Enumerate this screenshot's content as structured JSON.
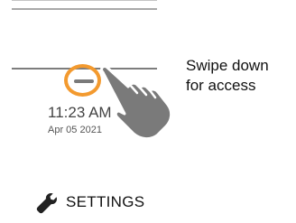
{
  "lock_screen": {
    "time": "11:23 AM",
    "date": "Apr 05 2021"
  },
  "instruction": {
    "line1": "Swipe down",
    "line2": "for access"
  },
  "settings": {
    "label": "SETTINGS",
    "icon": "wrench-icon"
  },
  "colors": {
    "highlight_ring": "#f39a2f",
    "hand_fill": "#7a7a7a",
    "text": "#111111"
  }
}
